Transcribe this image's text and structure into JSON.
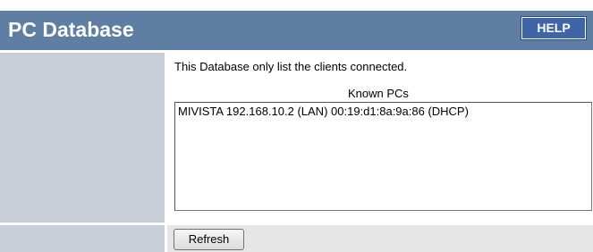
{
  "header": {
    "title": "PC Database",
    "help_label": "HELP"
  },
  "main": {
    "description": "This Database only list the clients connected.",
    "list_label": "Known PCs",
    "items": [
      "MIVISTA 192.168.10.2 (LAN) 00:19:d1:8a:9a:86 (DHCP)"
    ],
    "refresh_label": "Refresh"
  },
  "colors": {
    "header_bg": "#5e7ea4",
    "help_button_bg": "#3f64a8",
    "left_column_bg": "#c8cfdb",
    "footer_row_bg": "#e6e6e6"
  }
}
